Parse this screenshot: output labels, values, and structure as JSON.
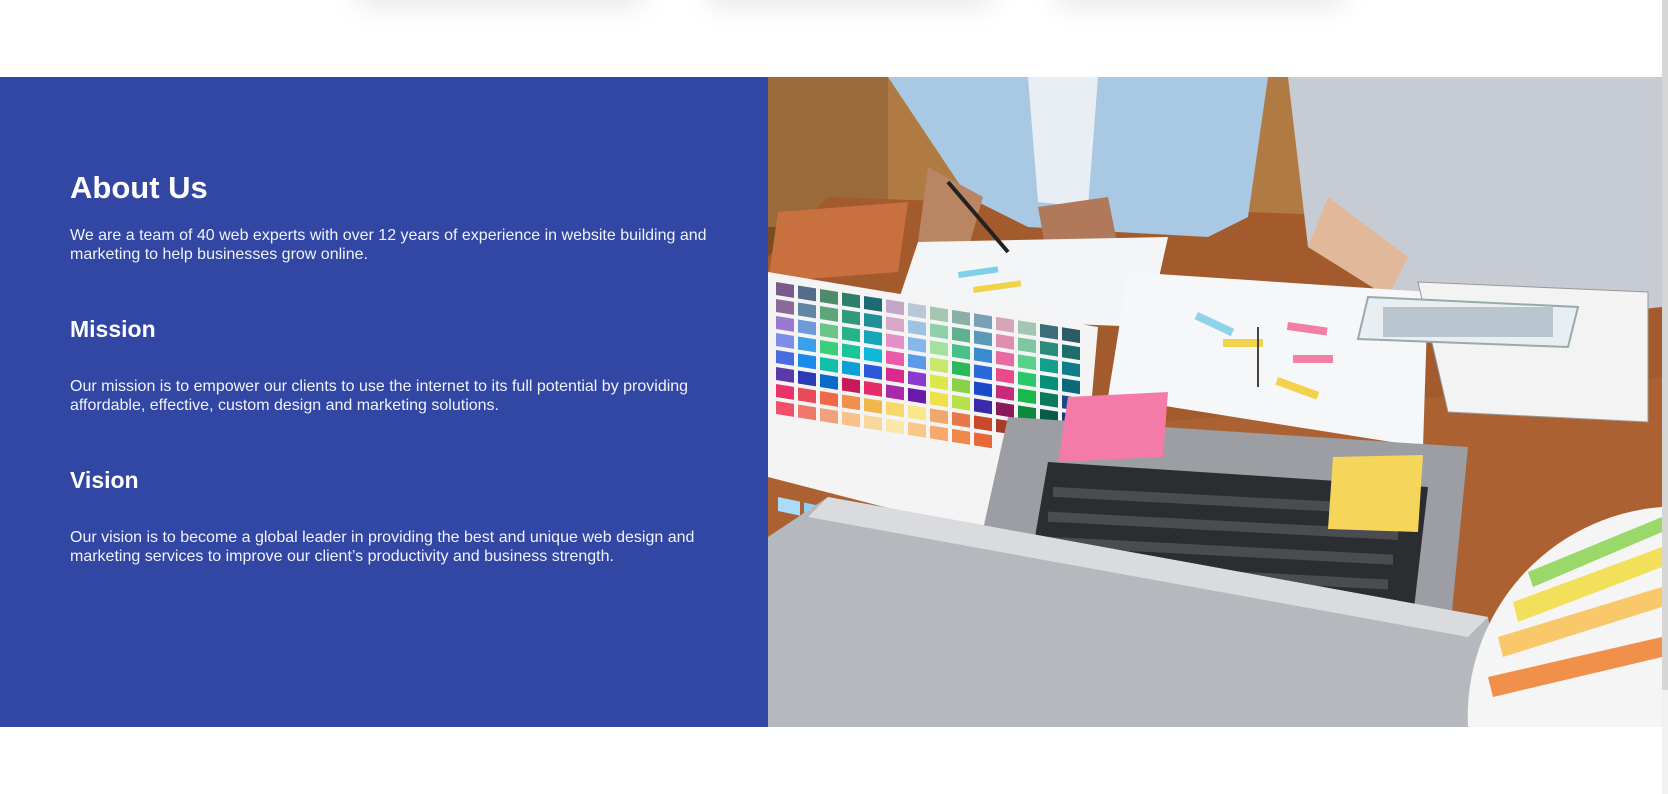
{
  "about": {
    "title": "About Us",
    "intro": "We are a team of 40 web experts with over 12 years of experience in website building and marketing to help businesses grow online.",
    "mission_title": "Mission",
    "mission_text": "Our mission is to empower our clients to use the internet to its full potential by providing affordable, effective, custom design and marketing solutions.",
    "vision_title": "Vision",
    "vision_text": "Our vision is to become a global leader in providing the best and unique web design and marketing services to improve our client’s productivity and business strength."
  },
  "colors": {
    "panel_bg": "#3246a3",
    "text": "#ffffff"
  },
  "image": {
    "subject": "team-working-with-color-swatches-laptop-and-tablet"
  }
}
